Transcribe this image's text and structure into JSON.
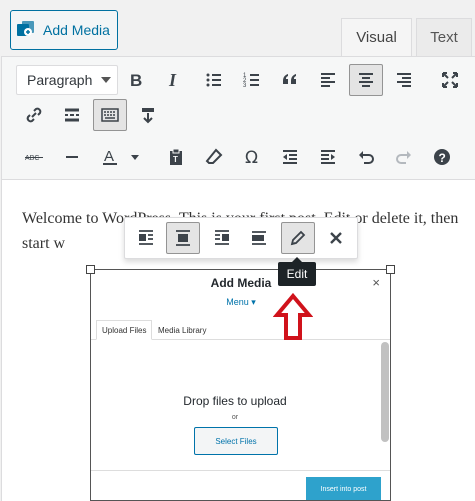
{
  "header": {
    "add_media_label": "Add Media",
    "tabs": [
      {
        "label": "Visual",
        "active": true
      },
      {
        "label": "Text",
        "active": false
      }
    ]
  },
  "toolbar": {
    "format_select_value": "Paragraph",
    "row1": [
      "bold-icon",
      "italic-icon",
      "bulleted-list-icon",
      "numbered-list-icon",
      "blockquote-icon",
      "align-left-icon",
      "align-center-icon",
      "align-right-icon",
      "fullscreen-icon"
    ],
    "row2": [
      "link-icon",
      "read-more-icon",
      "toolbar-toggle-icon",
      "insert-below-icon"
    ],
    "row3": [
      "strikethrough-icon",
      "horizontal-line-icon",
      "text-color-icon",
      "paste-text-icon",
      "clear-formatting-icon",
      "special-character-icon",
      "outdent-icon",
      "indent-icon",
      "undo-icon",
      "redo-icon",
      "help-icon"
    ]
  },
  "content": {
    "paragraph": "Welcome to WordPress. This is your first post. Edit or delete it, then start w"
  },
  "image_toolbar": {
    "buttons": [
      "align-left-icon",
      "align-center-icon",
      "align-right-icon",
      "no-align-icon",
      "edit-pencil-icon",
      "remove-icon"
    ],
    "tooltip": "Edit"
  },
  "embedded_image": {
    "title": "Add Media",
    "close": "×",
    "menu": "Menu ▾",
    "tabs": [
      "Upload Files",
      "Media Library"
    ],
    "drop_text": "Drop files to upload",
    "or_text": "or",
    "select_files": "Select Files",
    "insert_button": "Insert into post"
  },
  "colors": {
    "accent": "#0071a1",
    "arrow": "#d0121b",
    "tooltip_bg": "#1d2327"
  }
}
